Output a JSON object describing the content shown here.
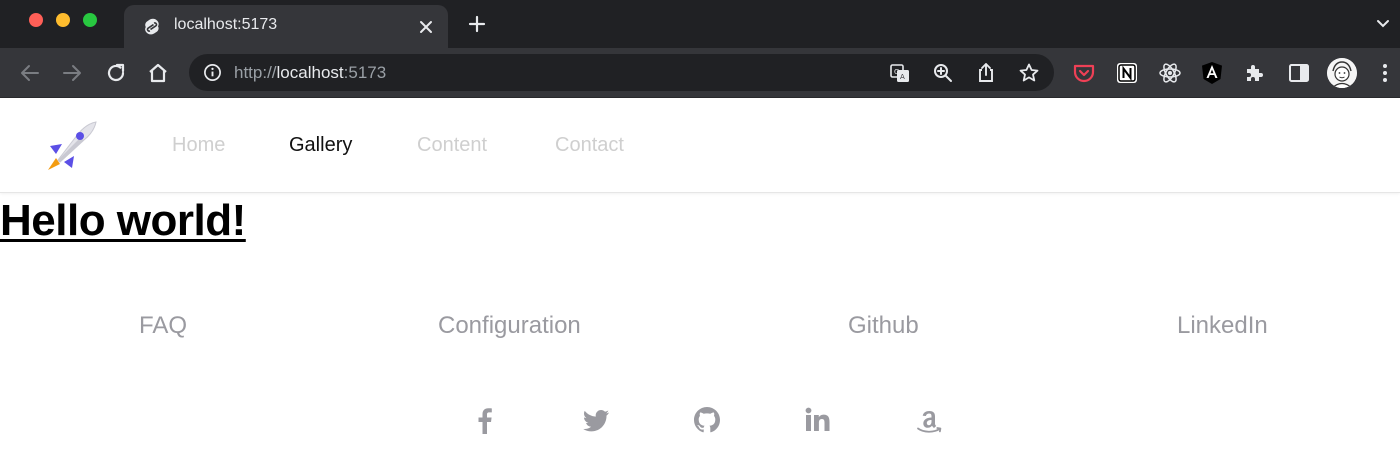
{
  "browser": {
    "tab": {
      "title": "localhost:5173",
      "favicon": "svelte-icon"
    },
    "address": {
      "scheme": "http://",
      "host": "localhost",
      "port": ":5173"
    },
    "nav_icons": [
      "back-arrow-icon",
      "forward-arrow-icon",
      "reload-icon",
      "home-icon"
    ],
    "omnibox_icons": [
      "translate-icon",
      "zoom-icon",
      "share-icon",
      "bookmark-star-icon"
    ],
    "extensions": [
      "pocket-icon",
      "notion-icon",
      "react-devtools-icon",
      "angular-icon",
      "extensions-puzzle-icon",
      "side-panel-icon"
    ],
    "profile": "avatar"
  },
  "site": {
    "logo": "rocket-icon",
    "nav": [
      {
        "label": "Home",
        "active": false
      },
      {
        "label": "Gallery",
        "active": true
      },
      {
        "label": "Content",
        "active": false
      },
      {
        "label": "Contact",
        "active": false
      }
    ],
    "heading": "Hello world!",
    "footer_links": [
      "FAQ",
      "Configuration",
      "Github",
      "LinkedIn"
    ],
    "social_icons": [
      "facebook-icon",
      "twitter-icon",
      "github-icon",
      "linkedin-icon",
      "amazon-icon"
    ]
  },
  "colors": {
    "chrome_dark": "#202124",
    "chrome_toolbar": "#35363a",
    "nav_inactive": "#cfcfcf",
    "nav_active": "#111111",
    "footer_gray": "#9a9aa0",
    "rocket_purple": "#5b4fe6",
    "rocket_orange": "#f39c12"
  }
}
